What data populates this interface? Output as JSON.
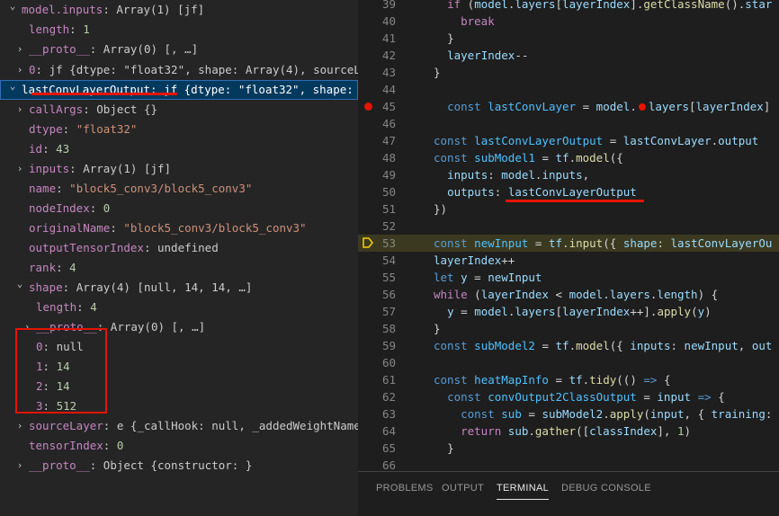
{
  "variables": {
    "rows": [
      {
        "chevron": "v",
        "name": "model.inputs",
        "value": "Array(1) [jf]"
      },
      {
        "name": "length",
        "value": "1"
      },
      {
        "chevron": ">",
        "name": "__proto__",
        "value": "Array(0) [, …]"
      },
      {
        "chevron": ">",
        "name": "0",
        "value": "jf {dtype: \"float32\", shape: Array(4), sourceLa…"
      },
      {
        "chevron": "v",
        "name": "lastConvLayerOutput",
        "value": "jf {dtype: \"float32\", shape: A…"
      },
      {
        "chevron": ">",
        "name": "callArgs",
        "value": "Object {}"
      },
      {
        "name": "dtype",
        "value": "\"float32\""
      },
      {
        "name": "id",
        "value": "43"
      },
      {
        "chevron": ">",
        "name": "inputs",
        "value": "Array(1) [jf]"
      },
      {
        "name": "name",
        "value": "\"block5_conv3/block5_conv3\""
      },
      {
        "name": "nodeIndex",
        "value": "0"
      },
      {
        "name": "originalName",
        "value": "\"block5_conv3/block5_conv3\""
      },
      {
        "name": "outputTensorIndex",
        "value": "undefined"
      },
      {
        "name": "rank",
        "value": "4"
      },
      {
        "chevron": "v",
        "name": "shape",
        "value": "Array(4) [null, 14, 14, …]"
      },
      {
        "name": "length",
        "value": "4"
      },
      {
        "chevron": ">",
        "name": "__proto__",
        "value": "Array(0) [, …]"
      },
      {
        "name": "0",
        "value": "null"
      },
      {
        "name": "1",
        "value": "14"
      },
      {
        "name": "2",
        "value": "14"
      },
      {
        "name": "3",
        "value": "512"
      },
      {
        "chevron": ">",
        "name": "sourceLayer",
        "value": "e {_callHook: null, _addedWeightNames…"
      },
      {
        "name": "tensorIndex",
        "value": "0"
      },
      {
        "chevron": ">",
        "name": "__proto__",
        "value": "Object {constructor: }"
      }
    ]
  },
  "editor": {
    "lines": [
      {
        "num": "39",
        "text": "    if (model.layers[layerIndex].getClassName().star"
      },
      {
        "num": "40",
        "text": "      break"
      },
      {
        "num": "41",
        "text": "    }"
      },
      {
        "num": "42",
        "text": "    layerIndex--"
      },
      {
        "num": "43",
        "text": "  }"
      },
      {
        "num": "44",
        "text": ""
      },
      {
        "num": "45",
        "text": "  const lastConvLayer = model.  layers[layerIndex]"
      },
      {
        "num": "46",
        "text": ""
      },
      {
        "num": "47",
        "text": "  const lastConvLayerOutput = lastConvLayer.output"
      },
      {
        "num": "48",
        "text": "  const subModel1 = tf.model({"
      },
      {
        "num": "49",
        "text": "    inputs: model.inputs,"
      },
      {
        "num": "50",
        "text": "    outputs: lastConvLayerOutput"
      },
      {
        "num": "51",
        "text": "  })"
      },
      {
        "num": "52",
        "text": ""
      },
      {
        "num": "53",
        "text": "  const newInput = tf.input({ shape: lastConvLayerOu"
      },
      {
        "num": "54",
        "text": "  layerIndex++"
      },
      {
        "num": "55",
        "text": "  let y = newInput"
      },
      {
        "num": "56",
        "text": "  while (layerIndex < model.layers.length) {"
      },
      {
        "num": "57",
        "text": "    y = model.layers[layerIndex++].apply(y)"
      },
      {
        "num": "58",
        "text": "  }"
      },
      {
        "num": "59",
        "text": "  const subModel2 = tf.model({ inputs: newInput, out"
      },
      {
        "num": "60",
        "text": ""
      },
      {
        "num": "61",
        "text": "  const heatMapInfo = tf.tidy(() => {"
      },
      {
        "num": "62",
        "text": "    const convOutput2ClassOutput = input => {"
      },
      {
        "num": "63",
        "text": "      const sub = subModel2.apply(input, { training:"
      },
      {
        "num": "64",
        "text": "      return sub.gather([classIndex], 1)"
      },
      {
        "num": "65",
        "text": "    }"
      },
      {
        "num": "66",
        "text": ""
      }
    ]
  },
  "panel": {
    "tabs": [
      "PROBLEMS",
      "OUTPUT",
      "TERMINAL",
      "DEBUG CONSOLE"
    ],
    "active_tab": "TERMINAL"
  },
  "colors": {
    "breakpoint": "#e51400",
    "annotation": "#e51400",
    "paused_line_bg": "#3b3a21",
    "selected_row_bg": "#04395e"
  },
  "icons": {
    "breakpoint": "breakpoint-icon",
    "paused_frame": "paused-frame-icon",
    "chevrons": "chevron-icon"
  }
}
